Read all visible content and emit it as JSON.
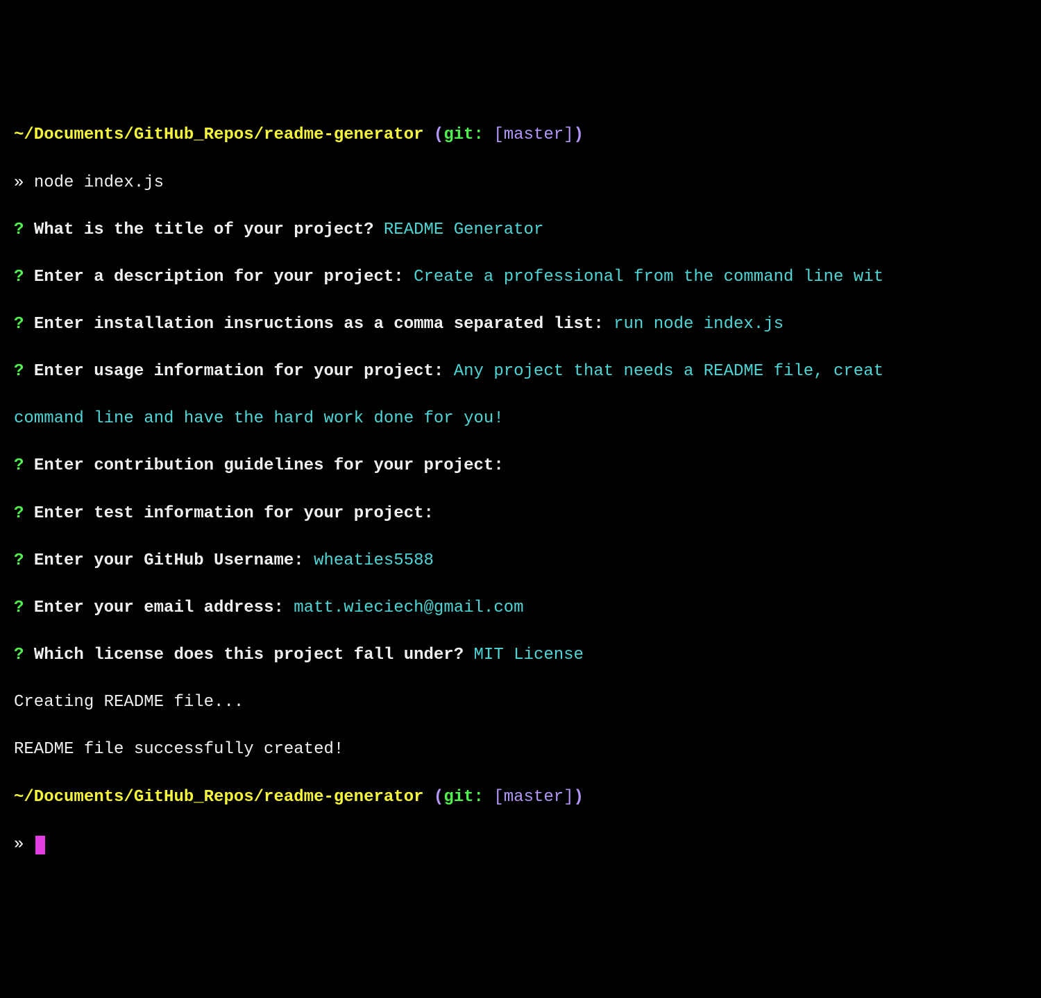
{
  "prompt1": {
    "path": "~/Documents/GitHub_Repos/readme-generator",
    "gitOpen": " (",
    "gitWord": "git:",
    "gitBranch": " [master]",
    "gitClose": ")"
  },
  "cmd1": {
    "arrow": "» ",
    "command": "node index.js"
  },
  "q": "? ",
  "questions": [
    {
      "prompt": "What is the title of your project?",
      "answer": " README Generator"
    },
    {
      "prompt": "Enter a description for your project:",
      "answer": " Create a professional from the command line wit"
    },
    {
      "prompt": "Enter installation insructions as a comma separated list:",
      "answer": " run node index.js"
    },
    {
      "prompt": "Enter usage information for your project:",
      "answer": " Any project that needs a README file, creat"
    },
    {
      "prompt": "",
      "answer": "command line and have the hard work done for you!"
    },
    {
      "prompt": "Enter contribution guidelines for your project:",
      "answer": ""
    },
    {
      "prompt": "Enter test information for your project:",
      "answer": ""
    },
    {
      "prompt": "Enter your GitHub Username:",
      "answer": " wheaties5588"
    },
    {
      "prompt": "Enter your email address:",
      "answer": " matt.wieciech@gmail.com"
    },
    {
      "prompt": "Which license does this project fall under?",
      "answer": " MIT License"
    }
  ],
  "status1": "Creating README file...",
  "status2": "README file successfully created!",
  "prompt2": {
    "path": "~/Documents/GitHub_Repos/readme-generator",
    "gitOpen": " (",
    "gitWord": "git:",
    "gitBranch": " [master]",
    "gitClose": ")"
  },
  "cmd2": {
    "arrow": "» "
  }
}
